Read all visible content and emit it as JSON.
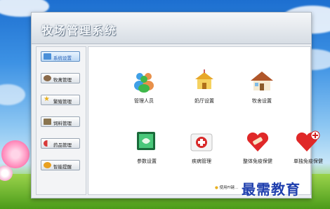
{
  "app": {
    "title": "牧场管理系统"
  },
  "sidebar": {
    "items": [
      {
        "label": "系统设置",
        "icon": "monitor-icon",
        "color": "#4a8fd8",
        "active": true
      },
      {
        "label": "牧禽管理",
        "icon": "person-icon",
        "color": "#8a6a4a",
        "active": false
      },
      {
        "label": "繁殖管理",
        "icon": "star-icon",
        "color": "#e8b020",
        "active": false
      },
      {
        "label": "饲料管理",
        "icon": "box-icon",
        "color": "#8a7550",
        "active": false
      },
      {
        "label": "药品管理",
        "icon": "pill-icon",
        "color": "#d83a3a",
        "active": false
      },
      {
        "label": "智能提醒",
        "icon": "alert-icon",
        "color": "#e8a020",
        "active": false
      }
    ]
  },
  "main": {
    "tiles": [
      {
        "label": "管理人员",
        "icon": "users-icon"
      },
      {
        "label": "奶厅设置",
        "icon": "hall-icon"
      },
      {
        "label": "牧舍设置",
        "icon": "house-icon"
      },
      {
        "label": "参数设置",
        "icon": "parameter-icon"
      },
      {
        "label": "疾病管理",
        "icon": "first-aid-icon"
      },
      {
        "label": "整体免疫保健",
        "icon": "heart-bandage-icon"
      },
      {
        "label": "单独免疫保健",
        "icon": "heart-plus-icon"
      }
    ],
    "footer": "使用FI键..."
  },
  "watermark": "最需教育"
}
